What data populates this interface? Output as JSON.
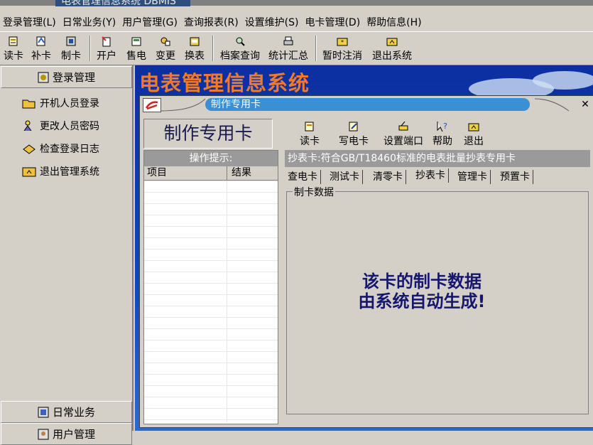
{
  "window": {
    "title": "电表管理信息系统 DBMIS"
  },
  "menubar": {
    "items": [
      {
        "label": "登录管理(L)"
      },
      {
        "label": "日常业务(Y)"
      },
      {
        "label": "用户管理(G)"
      },
      {
        "label": "查询报表(R)"
      },
      {
        "label": "设置维护(S)"
      },
      {
        "label": "电卡管理(D)"
      },
      {
        "label": "帮助信息(H)"
      }
    ]
  },
  "toolbar": {
    "read_card": "读卡",
    "reissue_card": "补卡",
    "make_card": "制卡",
    "open_account": "开户",
    "sell_power": "售电",
    "change": "变更",
    "replace_meter": "换表",
    "archive_query": "档案查询",
    "statistics": "统计汇总",
    "logout": "暂时注消",
    "exit_system": "退出系统"
  },
  "sidebar": {
    "header": "登录管理",
    "items": [
      {
        "label": "开机人员登录"
      },
      {
        "label": "更改人员密码"
      },
      {
        "label": "检查登录日志"
      },
      {
        "label": "退出管理系统"
      }
    ],
    "bottom_sections": [
      {
        "label": "日常业务"
      },
      {
        "label": "用户管理"
      }
    ]
  },
  "app": {
    "banner_title": "电表管理信息系统"
  },
  "child_window": {
    "caption": "制作专用卡",
    "heading": "制作专用卡",
    "buttons": {
      "read_card": "读卡",
      "write_card": "写电卡",
      "set_port": "设置端口",
      "help": "帮助",
      "exit": "退出"
    },
    "hints": {
      "header": "操作提示:",
      "col_item": "项目",
      "col_result": "结果"
    },
    "card_info": "抄表卡:符合GB/T18460标准的电表批量抄表专用卡",
    "tabs": [
      {
        "label": "查电卡"
      },
      {
        "label": "测试卡"
      },
      {
        "label": "清零卡"
      },
      {
        "label": "抄表卡"
      },
      {
        "label": "管理卡"
      },
      {
        "label": "预置卡"
      }
    ],
    "active_tab": "抄表卡",
    "group_label": "制卡数据",
    "message_line1": "该卡的制卡数据",
    "message_line2": "由系统自动生成!"
  }
}
